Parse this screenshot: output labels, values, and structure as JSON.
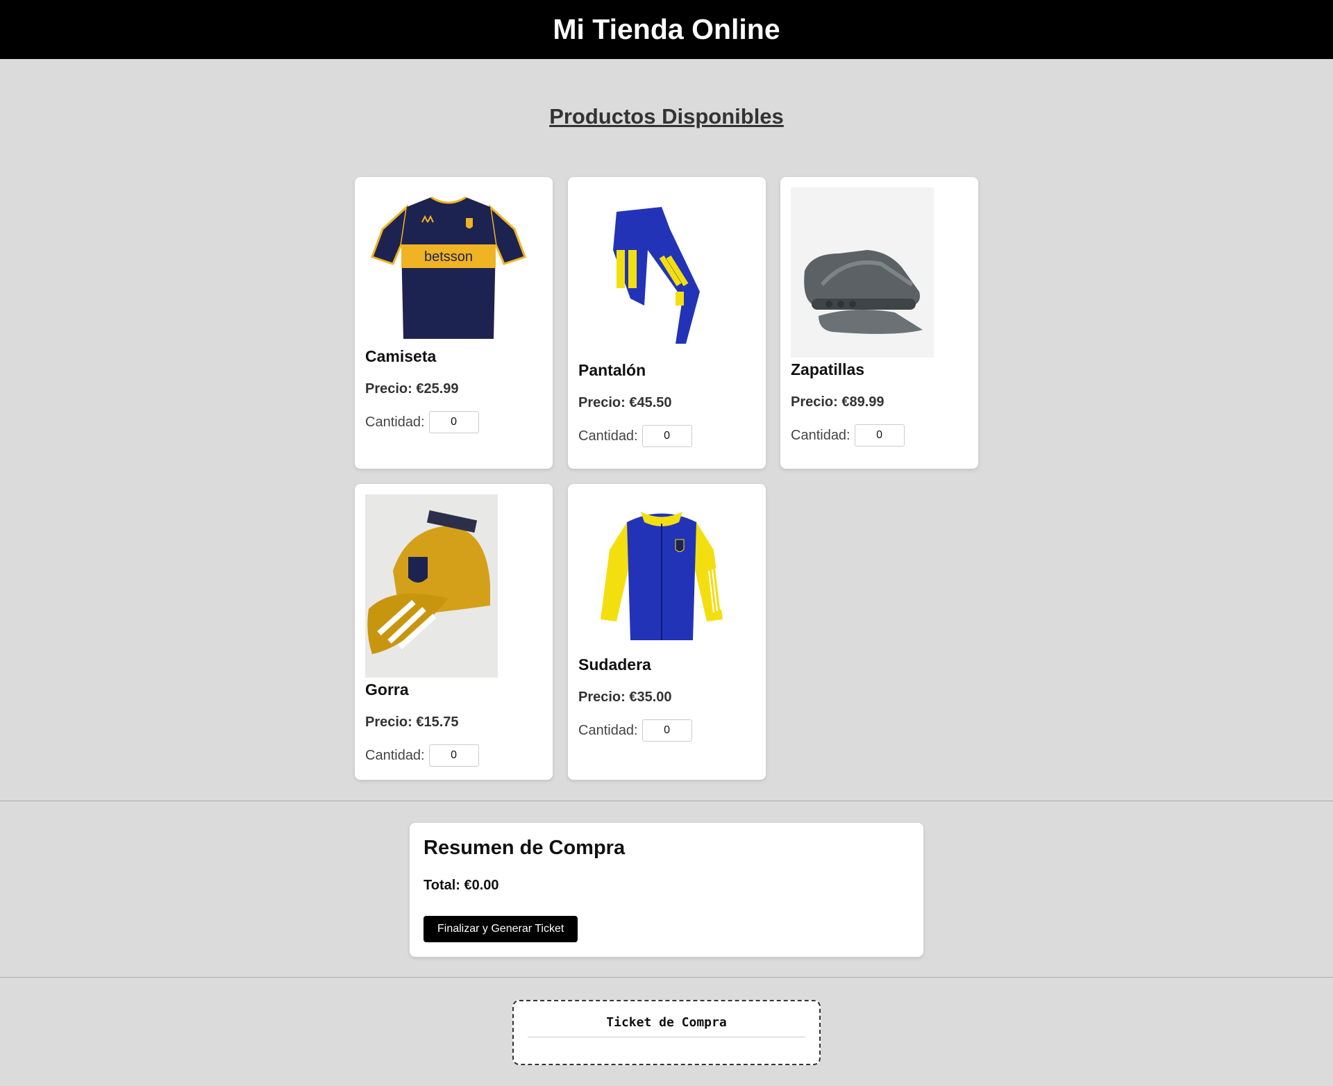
{
  "header": {
    "title": "Mi Tienda Online"
  },
  "products_section": {
    "title": "Productos Disponibles"
  },
  "labels": {
    "price_prefix": "Precio: ",
    "quantity_label": "Cantidad:"
  },
  "products": [
    {
      "name": "Camiseta",
      "price": "€25.99",
      "quantity": "0",
      "image": "jersey-image"
    },
    {
      "name": "Pantalón",
      "price": "€45.50",
      "quantity": "0",
      "image": "pants-image"
    },
    {
      "name": "Zapatillas",
      "price": "€89.99",
      "quantity": "0",
      "image": "sneakers-image"
    },
    {
      "name": "Gorra",
      "price": "€15.75",
      "quantity": "0",
      "image": "cap-image"
    },
    {
      "name": "Sudadera",
      "price": "€35.00",
      "quantity": "0",
      "image": "jacket-image"
    }
  ],
  "summary": {
    "title": "Resumen de Compra",
    "total_label": "Total: €0.00",
    "button_label": "Finalizar y Generar Ticket"
  },
  "ticket": {
    "title": "Ticket de Compra"
  },
  "colors": {
    "navy": "#1c2350",
    "gold": "#f0b323",
    "royal_blue": "#2233b8",
    "yellow": "#f3df10",
    "cap_gold": "#d4a019"
  }
}
